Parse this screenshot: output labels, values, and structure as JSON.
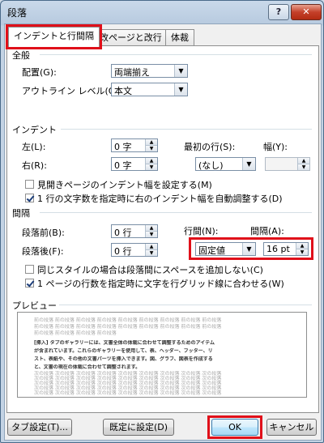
{
  "window": {
    "title": "段落",
    "help_label": "?",
    "close_label": "✕"
  },
  "tabs": [
    {
      "label": "インデントと行間隔"
    },
    {
      "label": "改ページと改行"
    },
    {
      "label": "体裁"
    }
  ],
  "general": {
    "title": "全般",
    "alignment_label": "配置(G):",
    "alignment_value": "両端揃え",
    "outline_label": "アウトライン レベル(O):",
    "outline_value": "本文"
  },
  "indent": {
    "title": "インデント",
    "left_label": "左(L):",
    "left_value": "0 字",
    "right_label": "右(R):",
    "right_value": "0 字",
    "first_line_label": "最初の行(S):",
    "first_line_value": "(なし)",
    "width_label": "幅(Y):",
    "width_value": "",
    "mirror_label": "見開きページのインデント幅を設定する(M)",
    "mirror_checked": false,
    "auto_adjust_label": "1 行の文字数を指定時に右のインデント幅を自動調整する(D)",
    "auto_adjust_checked": true
  },
  "spacing": {
    "title": "間隔",
    "before_label": "段落前(B):",
    "before_value": "0 行",
    "after_label": "段落後(F):",
    "after_value": "0 行",
    "line_spacing_label": "行間(N):",
    "line_spacing_value": "固定値",
    "at_label": "間隔(A):",
    "at_value": "16 pt",
    "no_space_label": "同じスタイルの場合は段落間にスペースを追加しない(C)",
    "no_space_checked": false,
    "snap_grid_label": "1 ページの行数を指定時に文字を行グリッド線に合わせる(W)",
    "snap_grid_checked": true
  },
  "preview": {
    "title": "プレビュー",
    "prev_lines": [
      "前の段落 前の段落 前の段落 前の段落 前の段落 前の段落 前の段落 前の段落 前の段落",
      "前の段落 前の段落 前の段落 前の段落 前の段落 前の段落 前の段落 前の段落 前の段落",
      "前の段落 前の段落 前の段落 前の段落"
    ],
    "body_lines": [
      "[挿入] タブのギャラリーには、文書全体の体裁に合わせて調整するためのアイテム",
      "が含まれています。これらのギャラリーを使用して、表、ヘッダー、フッター、リ",
      "スト、表紙や、その他の文書パーツを挿入できます。図、グラフ、図表を作成する",
      "と、文書の現在の体裁に合わせて調整されます。"
    ],
    "next_lines": [
      "次の段落 次の段落 次の段落 次の段落 次の段落 次の段落 次の段落 次の段落 次の段落",
      "次の段落 次の段落 次の段落 次の段落 次の段落 次の段落 次の段落 次の段落 次の段落",
      "次の段落 次の段落 次の段落 次の段落 次の段落 次の段落 次の段落 次の段落 次の段落",
      "次の段落 次の段落 次の段落 次の段落 次の段落 次の段落 次の段落 次の段落 次の段落",
      "次の段落 次の段落 次の段落 次の段落 次の段落 次の段落 次の段落 次の段落 次の段落"
    ]
  },
  "buttons": {
    "tabs_label": "タブ設定(T)...",
    "default_label": "既定に設定(D)",
    "ok_label": "OK",
    "cancel_label": "キャンセル"
  },
  "colors": {
    "highlight": "#e0101a"
  }
}
